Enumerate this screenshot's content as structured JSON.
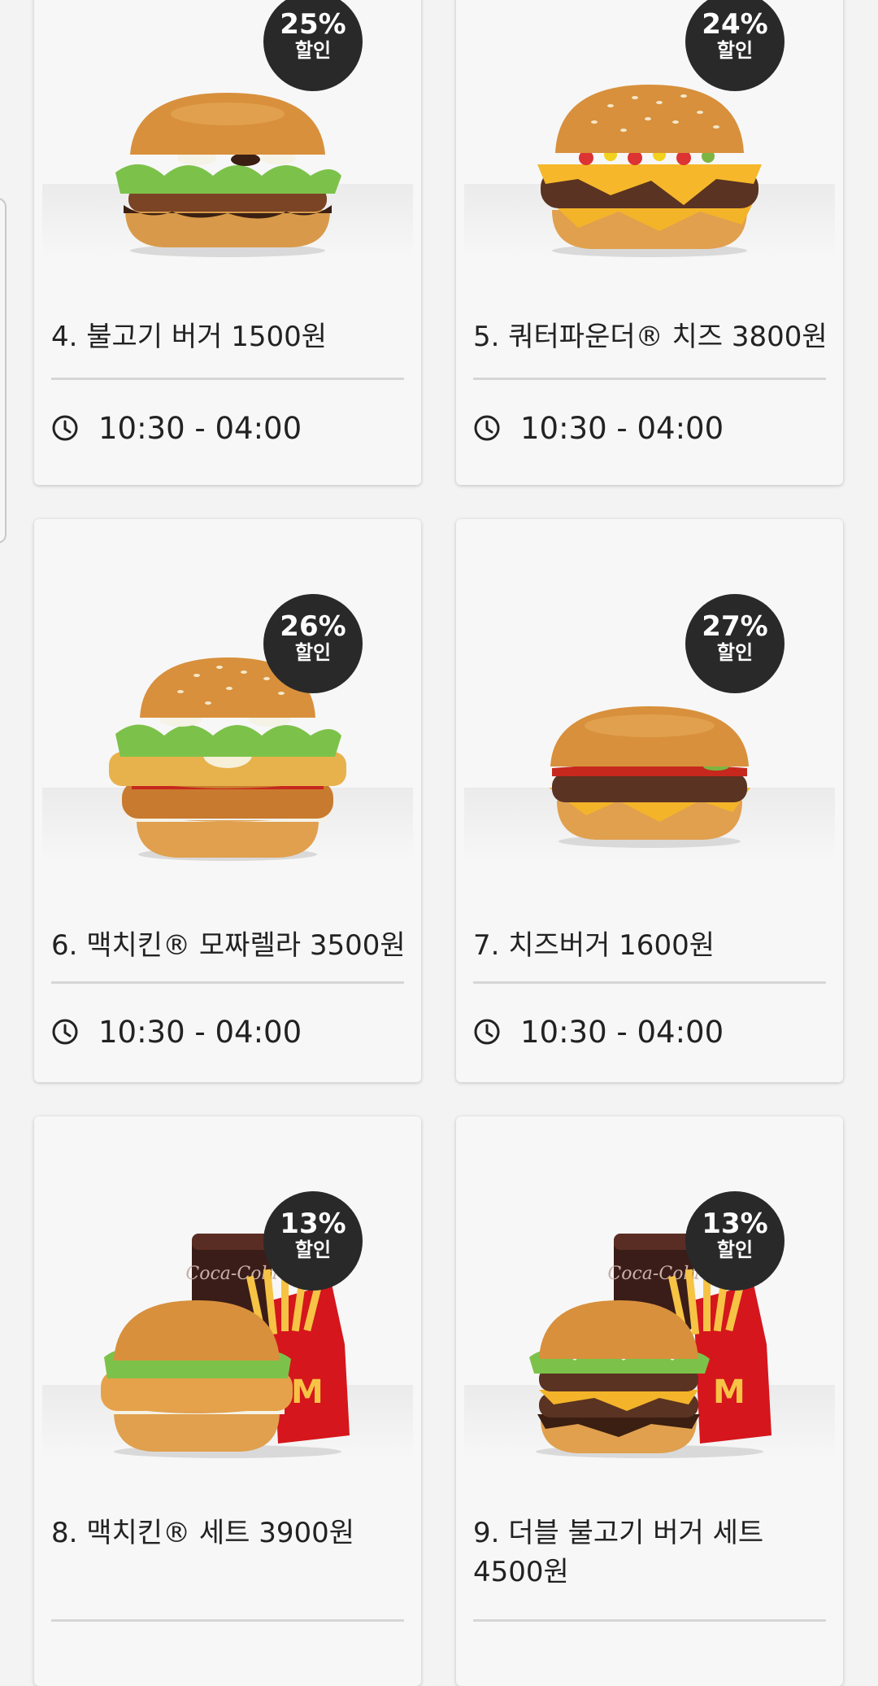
{
  "cards": [
    {
      "name": "4. 불고기 버거 1500원",
      "discount_pct": "25%",
      "discount_word": "할인",
      "hours": "10:30 - 04:00"
    },
    {
      "name": "5. 쿼터파운더® 치즈 3800원",
      "discount_pct": "24%",
      "discount_word": "할인",
      "hours": "10:30 - 04:00"
    },
    {
      "name": "6. 맥치킨® 모짜렐라 3500원",
      "discount_pct": "26%",
      "discount_word": "할인",
      "hours": "10:30 - 04:00"
    },
    {
      "name": "7. 치즈버거 1600원",
      "discount_pct": "27%",
      "discount_word": "할인",
      "hours": "10:30 - 04:00"
    },
    {
      "name": "8. 맥치킨® 세트 3900원",
      "discount_pct": "13%",
      "discount_word": "할인",
      "hours": ""
    },
    {
      "name": "9. 더블 불고기 버거 세트 4500원",
      "discount_pct": "13%",
      "discount_word": "할인",
      "hours": ""
    }
  ],
  "icons": {
    "clock": "clock-icon",
    "product": "product-image"
  },
  "colors": {
    "badge": "#292929",
    "background": "#f3f3f3",
    "card": "#f7f7f7",
    "text": "#222222"
  }
}
